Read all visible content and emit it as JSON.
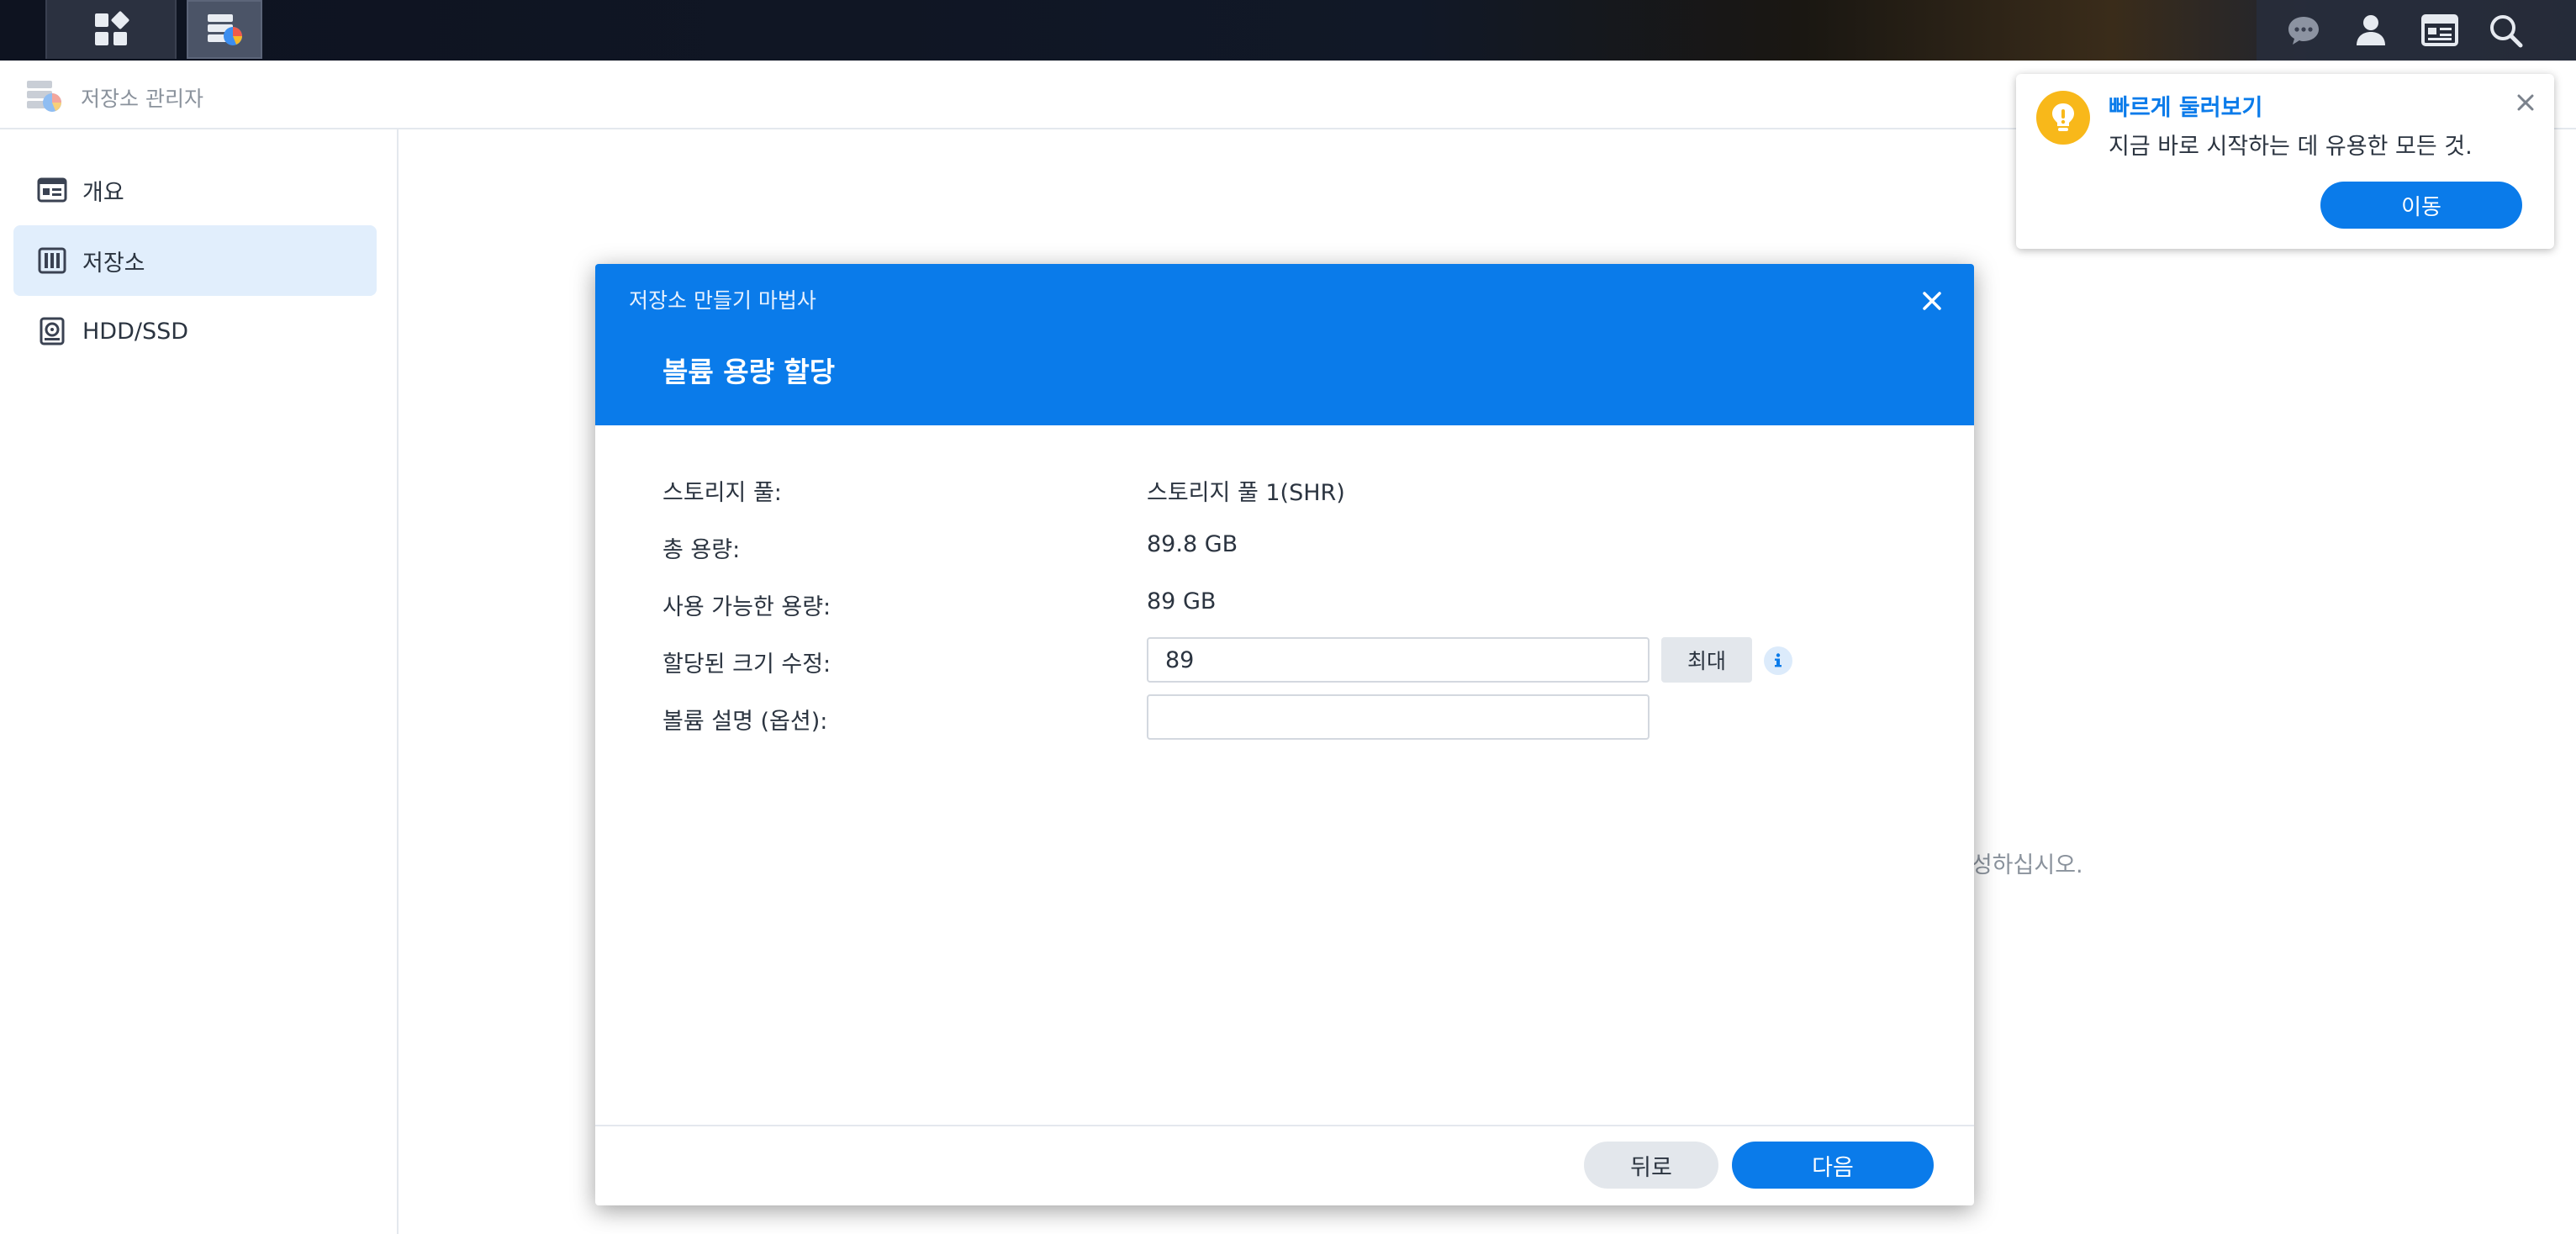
{
  "app": {
    "title": "저장소 관리자",
    "icon": "storage-manager-icon"
  },
  "taskbar": {
    "apps_icon": "grid-apps-icon",
    "storage_icon": "storage-manager-icon",
    "right_icons": [
      "chat-icon",
      "user-icon",
      "widget-icon",
      "search-icon"
    ]
  },
  "sidebar": {
    "items": [
      {
        "label": "개요",
        "icon": "overview-icon",
        "active": false
      },
      {
        "label": "저장소",
        "icon": "storage-icon",
        "active": true
      },
      {
        "label": "HDD/SSD",
        "icon": "hdd-icon",
        "active": false
      }
    ]
  },
  "main": {
    "background_text": "생성하십시오."
  },
  "tour": {
    "title": "빠르게 둘러보기",
    "text": "지금 바로 시작하는 데 유용한 모든 것.",
    "button": "이동"
  },
  "dialog": {
    "title": "저장소 만들기 마법사",
    "step_title": "볼륨 용량 할당",
    "rows": {
      "pool_label": "스토리지 풀:",
      "pool_value": "스토리지 풀 1(SHR)",
      "total_label": "총 용량:",
      "total_value": "89.8 GB",
      "avail_label": "사용 가능한 용량:",
      "avail_value": "89 GB",
      "alloc_label": "할당된 크기 수정:",
      "alloc_value": "89",
      "desc_label": "볼륨 설명 (옵션):",
      "desc_value": ""
    },
    "max_button": "최대",
    "back_button": "뒤로",
    "next_button": "다음"
  },
  "colors": {
    "accent": "#0a7bea",
    "sidebar_active": "#e1eefc",
    "bulb": "#f8b81a"
  }
}
